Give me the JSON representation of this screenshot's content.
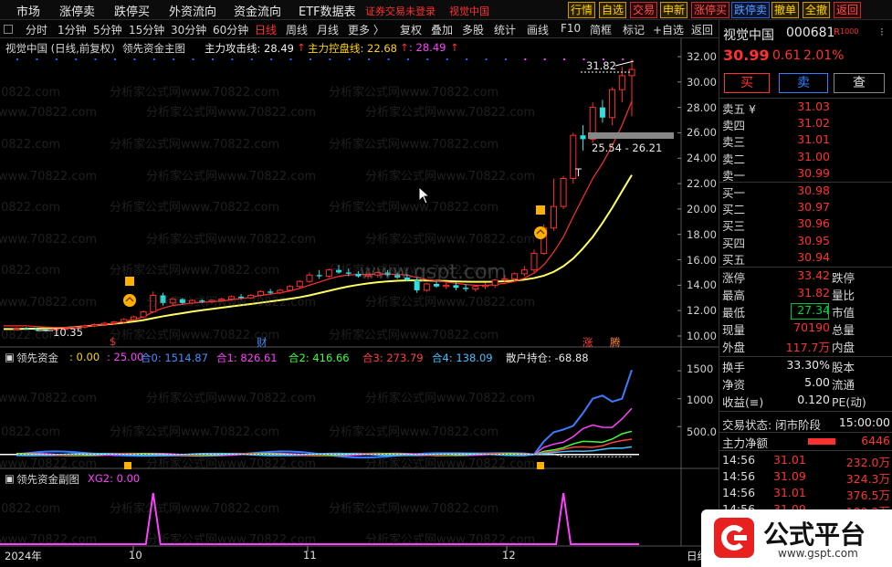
{
  "menubar": {
    "items": [
      "市场",
      "涨停卖",
      "跌停买",
      "外资流向",
      "资金流向",
      "ETF数据表"
    ],
    "warning": "证券交易未登录",
    "warning2": "视觉中国",
    "buttons": [
      "行情",
      "自选",
      "交易",
      "申新",
      "涨停买",
      "跌停卖",
      "撤单",
      "全撤",
      "返回"
    ]
  },
  "toolbar": {
    "periods": [
      "分时",
      "1分钟",
      "5分钟",
      "15分钟",
      "30分钟",
      "60分钟",
      "日线",
      "周线",
      "月线",
      "更多 〉"
    ],
    "active_period": "日线",
    "tools": [
      "复权",
      "叠加",
      "多股",
      "统计",
      "画线",
      "F10",
      "简框",
      "标记",
      "+自选",
      "返回"
    ]
  },
  "main_panel": {
    "title": "视觉中国 (日线,前复权)",
    "indicator_name": "领先资金主图",
    "line1_label": "主力攻击线: 28.49",
    "line1_arrow": "↑",
    "line2_label": "主力控盘线: 22.68",
    "line2_arrow": "↑",
    "line3_label": ": 28.49",
    "line3_arrow": "↑",
    "high_label": "31.82",
    "range_label": "25.54 - 26.21",
    "low_label": "10.35",
    "marker_cai": "财",
    "marker_zhang": "涨",
    "marker_teng": "腾",
    "marker_dollar": "$",
    "marker_T": "T",
    "y_ticks": [
      "32.00",
      "30.00",
      "28.00",
      "26.00",
      "24.00",
      "22.00",
      "20.00",
      "18.00",
      "16.00",
      "14.00",
      "12.00",
      "10.00"
    ]
  },
  "sub1": {
    "name": "领先资金",
    "items": [
      {
        "text": ": 0.00",
        "color": "#ffd400"
      },
      {
        "text": ": 25.00",
        "color": "#ff40ff"
      },
      {
        "text": "合0: 1514.87",
        "color": "#4a8cff"
      },
      {
        "text": "合1: 826.61",
        "color": "#ff40ff"
      },
      {
        "text": "合2: 416.66",
        "color": "#40ff40"
      },
      {
        "text": "合3: 273.79",
        "color": "#ff4040"
      },
      {
        "text": "合4: 138.09",
        "color": "#40c0ff"
      },
      {
        "text": "散户持仓: -68.88",
        "color": "#e8e8e8"
      }
    ],
    "y_ticks": [
      "1500",
      "1000",
      "500.0"
    ]
  },
  "sub2": {
    "name": "领先资金副图",
    "item": "XG2: 0.00"
  },
  "xaxis": {
    "labels": [
      "2024年",
      "10",
      "11",
      "12"
    ],
    "right_label": "日线"
  },
  "watermark": {
    "text": "分析家公式网www.70822.com",
    "center": "www.gspt.com"
  },
  "quote": {
    "name": "视觉中国",
    "code": "000681",
    "flag": "R",
    "flag2": "1000",
    "price": "30.99",
    "change": "0.61",
    "pct": "2.01%",
    "buy_btn": "买",
    "sell_btn": "卖",
    "query_btn": "查",
    "asks": [
      {
        "label": "卖五 ¥",
        "price": "31.03"
      },
      {
        "label": "卖四",
        "price": "31.02"
      },
      {
        "label": "卖三",
        "price": "31.01"
      },
      {
        "label": "卖二",
        "price": "31.00"
      },
      {
        "label": "卖一",
        "price": "30.99"
      }
    ],
    "bids": [
      {
        "label": "买一",
        "price": "30.98"
      },
      {
        "label": "买二",
        "price": "30.97"
      },
      {
        "label": "买三",
        "price": "30.96"
      },
      {
        "label": "买四",
        "price": "30.95"
      },
      {
        "label": "买五",
        "price": "30.94"
      }
    ],
    "stats": [
      {
        "l1": "涨停",
        "v1": "33.42",
        "c1": "red",
        "l2": "跌停",
        "v2": ""
      },
      {
        "l1": "最高",
        "v1": "31.82",
        "c1": "red",
        "l2": "量比",
        "v2": ""
      },
      {
        "l1": "最低",
        "v1": "27.34",
        "c1": "green",
        "l2": "市值",
        "v2": ""
      },
      {
        "l1": "现量",
        "v1": "70190",
        "c1": "red",
        "l2": "总量",
        "v2": ""
      },
      {
        "l1": "外盘",
        "v1": "117.7万",
        "c1": "red",
        "l2": "内盘",
        "v2": ""
      }
    ],
    "stats2": [
      {
        "l1": "换手",
        "v1": "33.30%",
        "l2": "股本"
      },
      {
        "l1": "净资",
        "v1": "5.00",
        "l2": "流通"
      },
      {
        "l1": "收益(≡)",
        "v1": "0.120",
        "l2": "PE(动)"
      }
    ],
    "trade_status_label": "交易状态: 闭市阶段",
    "trade_time": "15:00:00",
    "net_label": "主力净额",
    "net_value": "6446",
    "ticks": [
      {
        "time": "14:56",
        "price": "31.01",
        "vol": "232.0万"
      },
      {
        "time": "14:56",
        "price": "31.09",
        "vol": "324.3万"
      },
      {
        "time": "14:56",
        "price": "31.01",
        "vol": "376.5万"
      },
      {
        "time": "14:56",
        "price": "31.09",
        "vol": "189.2万"
      }
    ]
  },
  "logo": {
    "text": "公式平台",
    "url": "www.gspt.com"
  },
  "chart_data": {
    "type": "candlestick",
    "y_range": [
      10.0,
      32.0
    ],
    "candles": [
      [
        10.6,
        10.7,
        10.5,
        10.6
      ],
      [
        10.6,
        10.7,
        10.5,
        10.55
      ],
      [
        10.55,
        10.65,
        10.4,
        10.5
      ],
      [
        10.5,
        10.6,
        10.35,
        10.45
      ],
      [
        10.45,
        10.6,
        10.4,
        10.55
      ],
      [
        10.55,
        10.7,
        10.45,
        10.6
      ],
      [
        10.6,
        10.75,
        10.5,
        10.7
      ],
      [
        10.7,
        10.9,
        10.6,
        10.8
      ],
      [
        10.8,
        11.0,
        10.7,
        10.9
      ],
      [
        10.9,
        11.1,
        10.8,
        11.0
      ],
      [
        11.0,
        11.2,
        10.9,
        11.1
      ],
      [
        11.1,
        11.4,
        11.0,
        11.3
      ],
      [
        11.3,
        11.6,
        11.2,
        11.5
      ],
      [
        11.5,
        12.0,
        11.4,
        11.9
      ],
      [
        11.9,
        13.5,
        11.8,
        13.2
      ],
      [
        13.2,
        13.4,
        12.4,
        12.6
      ],
      [
        12.6,
        13.0,
        12.4,
        12.9
      ],
      [
        12.9,
        13.0,
        12.5,
        12.6
      ],
      [
        12.6,
        12.9,
        12.5,
        12.8
      ],
      [
        12.8,
        12.9,
        12.6,
        12.7
      ],
      [
        12.7,
        12.9,
        12.6,
        12.8
      ],
      [
        12.8,
        13.0,
        12.7,
        12.9
      ],
      [
        12.9,
        13.2,
        12.8,
        13.1
      ],
      [
        13.1,
        13.3,
        12.9,
        13.0
      ],
      [
        13.0,
        13.3,
        12.9,
        13.2
      ],
      [
        13.2,
        13.6,
        13.1,
        13.5
      ],
      [
        13.5,
        13.7,
        13.3,
        13.4
      ],
      [
        13.4,
        13.7,
        13.3,
        13.6
      ],
      [
        13.6,
        14.0,
        13.5,
        13.9
      ],
      [
        13.9,
        14.4,
        13.8,
        14.3
      ],
      [
        14.3,
        15.0,
        14.2,
        14.8
      ],
      [
        14.8,
        15.2,
        14.5,
        14.7
      ],
      [
        14.7,
        15.3,
        14.6,
        15.2
      ],
      [
        15.2,
        15.6,
        14.9,
        15.0
      ],
      [
        15.0,
        15.3,
        14.7,
        14.9
      ],
      [
        14.9,
        15.1,
        14.6,
        14.7
      ],
      [
        14.7,
        15.0,
        14.5,
        14.8
      ],
      [
        14.8,
        15.1,
        14.6,
        15.0
      ],
      [
        15.0,
        15.2,
        14.7,
        14.8
      ],
      [
        14.8,
        15.0,
        14.5,
        14.6
      ],
      [
        14.6,
        14.9,
        14.3,
        14.4
      ],
      [
        14.4,
        14.6,
        13.4,
        13.6
      ],
      [
        13.6,
        14.2,
        13.5,
        14.1
      ],
      [
        14.1,
        14.3,
        13.8,
        13.9
      ],
      [
        13.9,
        14.2,
        13.7,
        14.0
      ],
      [
        14.0,
        14.2,
        13.6,
        13.8
      ],
      [
        13.8,
        14.1,
        13.5,
        13.7
      ],
      [
        13.7,
        14.0,
        13.5,
        13.9
      ],
      [
        13.9,
        14.2,
        13.7,
        14.0
      ],
      [
        14.0,
        14.5,
        13.8,
        14.4
      ],
      [
        14.4,
        14.8,
        14.2,
        14.5
      ],
      [
        14.5,
        15.0,
        14.3,
        14.9
      ],
      [
        14.9,
        15.5,
        14.7,
        15.2
      ],
      [
        15.2,
        16.8,
        15.0,
        16.5
      ],
      [
        16.5,
        18.8,
        16.4,
        18.5
      ],
      [
        18.5,
        22.4,
        18.3,
        20.2
      ],
      [
        20.2,
        22.6,
        20.0,
        22.4
      ],
      [
        22.4,
        26.0,
        22.0,
        25.8
      ],
      [
        25.8,
        26.6,
        24.6,
        25.5
      ],
      [
        25.5,
        28.4,
        25.2,
        28.0
      ],
      [
        28.0,
        28.6,
        26.8,
        27.2
      ],
      [
        27.2,
        29.6,
        26.6,
        29.4
      ],
      [
        29.4,
        31.2,
        28.4,
        30.5
      ],
      [
        30.5,
        31.8,
        27.3,
        30.99
      ]
    ],
    "ma_fast": [
      10.8,
      10.8,
      10.75,
      10.7,
      10.68,
      10.67,
      10.7,
      10.75,
      10.82,
      10.9,
      11.0,
      11.15,
      11.3,
      11.5,
      11.9,
      12.2,
      12.4,
      12.5,
      12.6,
      12.65,
      12.7,
      12.75,
      12.85,
      12.95,
      13.05,
      13.2,
      13.3,
      13.4,
      13.55,
      13.75,
      14.0,
      14.25,
      14.5,
      14.7,
      14.8,
      14.85,
      14.85,
      14.87,
      14.88,
      14.85,
      14.8,
      14.6,
      14.45,
      14.35,
      14.25,
      14.15,
      14.05,
      14.0,
      13.98,
      14.05,
      14.15,
      14.3,
      14.55,
      14.95,
      15.6,
      16.6,
      17.8,
      19.4,
      20.9,
      22.4,
      23.6,
      25.0,
      26.6,
      28.49
    ],
    "ma_slow": [
      10.55,
      10.57,
      10.58,
      10.6,
      10.62,
      10.65,
      10.7,
      10.76,
      10.83,
      10.9,
      10.97,
      11.05,
      11.14,
      11.25,
      11.4,
      11.55,
      11.68,
      11.8,
      11.92,
      12.03,
      12.13,
      12.23,
      12.33,
      12.43,
      12.52,
      12.62,
      12.72,
      12.82,
      12.93,
      13.05,
      13.2,
      13.38,
      13.56,
      13.74,
      13.9,
      14.03,
      14.14,
      14.23,
      14.3,
      14.35,
      14.38,
      14.38,
      14.37,
      14.35,
      14.33,
      14.3,
      14.28,
      14.27,
      14.27,
      14.28,
      14.31,
      14.36,
      14.44,
      14.56,
      14.75,
      15.05,
      15.5,
      16.1,
      16.9,
      17.8,
      18.9,
      20.1,
      21.4,
      22.68
    ],
    "sub1_series": [
      {
        "name": "合0",
        "color": "#3a7cff",
        "end": 1514.87
      },
      {
        "name": "合1",
        "color": "#ff40ff",
        "end": 826.61
      },
      {
        "name": "合2",
        "color": "#40ff40",
        "end": 416.66
      },
      {
        "name": "合3",
        "color": "#ff4040",
        "end": 273.79
      },
      {
        "name": "合4",
        "color": "#40c0ff",
        "end": 138.09
      }
    ],
    "sub1_range": [
      -200,
      1600
    ],
    "xg2_spikes": [
      14,
      56
    ]
  }
}
